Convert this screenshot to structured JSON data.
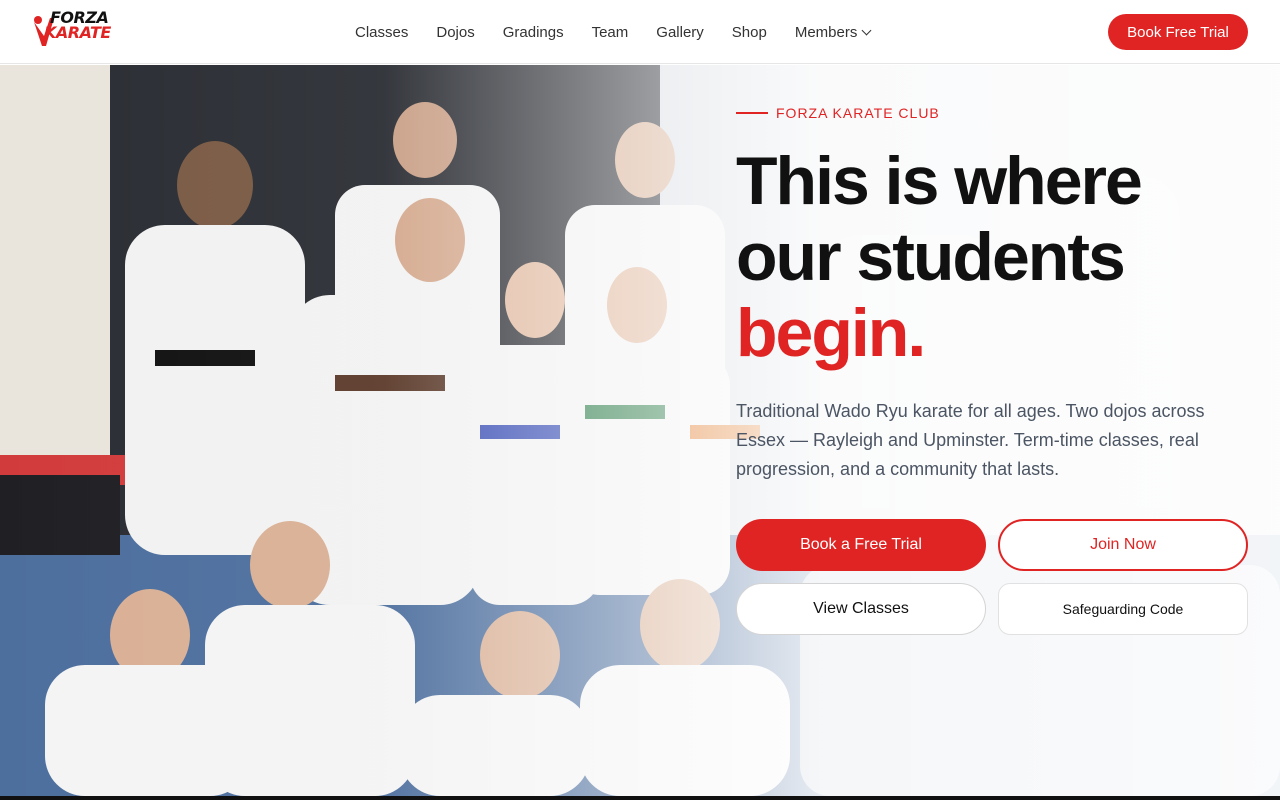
{
  "brand": {
    "name_line1": "FORZA",
    "name_line2": "KARATE",
    "accent": "#e02424"
  },
  "nav": {
    "items": [
      {
        "label": "Classes"
      },
      {
        "label": "Dojos"
      },
      {
        "label": "Gradings"
      },
      {
        "label": "Team"
      },
      {
        "label": "Gallery"
      },
      {
        "label": "Shop"
      },
      {
        "label": "Members",
        "icon": "chevron-down-icon"
      }
    ],
    "cta_label": "Book Free Trial"
  },
  "hero": {
    "eyebrow": "FORZA KARATE CLUB",
    "headline_line1": "This is where",
    "headline_line2": "our students",
    "headline_accent": "begin",
    "headline_period": ".",
    "lead": "Traditional Wado Ryu karate for all ages. Two dojos across Essex — Rayleigh and Upminster. Term-time classes, real progression, and a community that lasts.",
    "buttons": {
      "book_trial": "Book a Free Trial",
      "join_now": "Join Now",
      "view_classes": "View Classes",
      "safeguarding": "Safeguarding Code"
    },
    "image": "group-photo-karate-students"
  }
}
